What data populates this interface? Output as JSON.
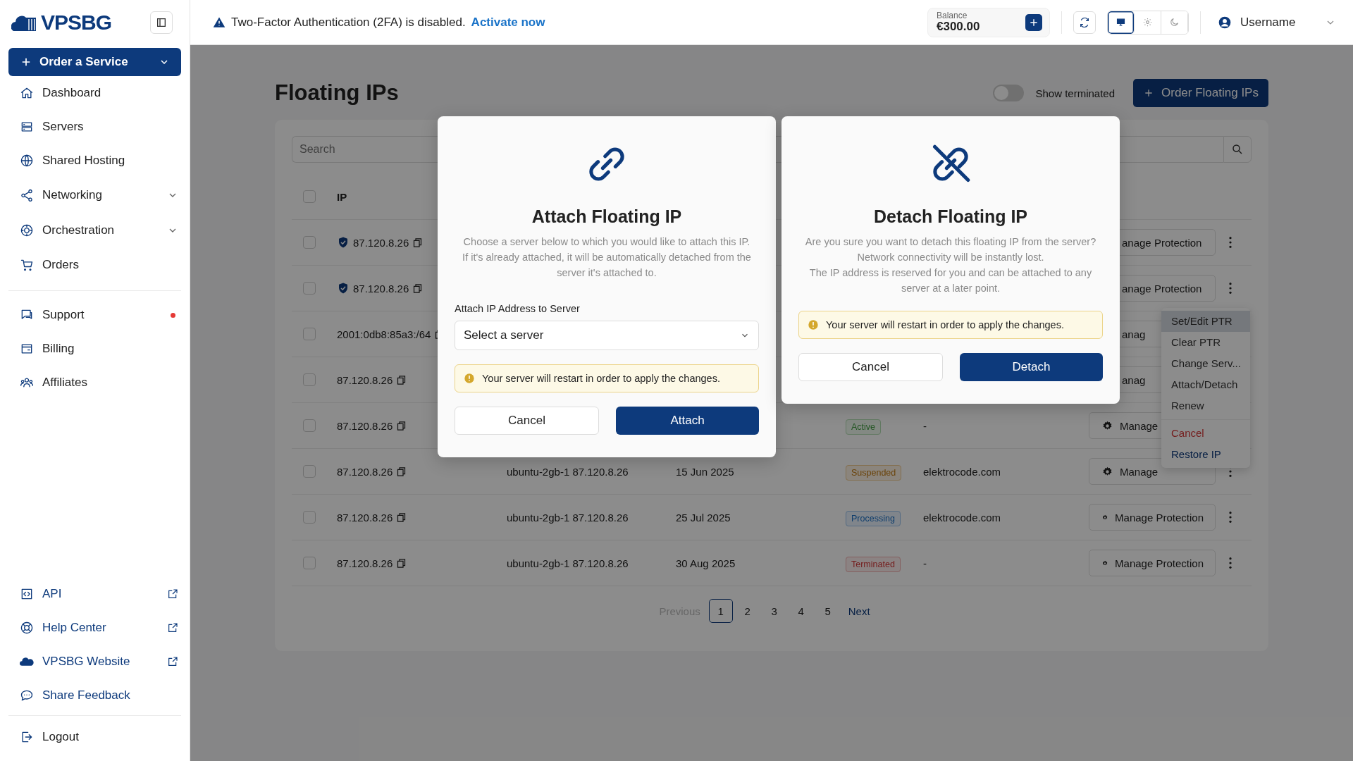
{
  "logo": {
    "text": "VPSBG"
  },
  "sidebar": {
    "order_button": "Order a Service",
    "groups": [
      {
        "items": [
          {
            "label": "Dashboard",
            "kind": "page"
          },
          {
            "label": "Servers",
            "kind": "page"
          },
          {
            "label": "Shared Hosting",
            "kind": "page"
          },
          {
            "label": "Networking",
            "kind": "page",
            "expandable": true
          },
          {
            "label": "Orchestration",
            "kind": "page",
            "expandable": true
          },
          {
            "label": "Orders",
            "kind": "page"
          }
        ]
      },
      {
        "items": [
          {
            "label": "Support",
            "kind": "page",
            "notification": true
          },
          {
            "label": "Billing",
            "kind": "page"
          },
          {
            "label": "Affiliates",
            "kind": "page"
          }
        ]
      },
      {
        "items": [
          {
            "label": "API",
            "kind": "link",
            "external": true
          },
          {
            "label": "Help Center",
            "kind": "link",
            "external": true
          },
          {
            "label": "VPSBG Website",
            "kind": "link",
            "external": true
          },
          {
            "label": "Share Feedback",
            "kind": "link"
          }
        ]
      },
      {
        "items": [
          {
            "label": "Logout",
            "kind": "page"
          }
        ]
      }
    ]
  },
  "topbar": {
    "alert": {
      "text": "Two-Factor Authentication (2FA) is disabled.",
      "link": "Activate now"
    },
    "balance": {
      "label": "Balance",
      "amount": "€300.00"
    },
    "theme_modes": [
      {
        "selected": true
      },
      {
        "selected": false
      },
      {
        "selected": false
      }
    ],
    "user": {
      "name": "Username"
    }
  },
  "page": {
    "title": "Floating IPs",
    "show_terminated": {
      "label": "Show terminated",
      "on": false
    },
    "order_button": "Order Floating IPs",
    "search": {
      "placeholder": "Search"
    },
    "table": {
      "columns": [
        {
          "label": "IP"
        }
      ],
      "header_checked": false,
      "rows": [
        {
          "checked": false,
          "protected": true,
          "ip": "87.120.8.26",
          "manage": {
            "label": "anage Protection",
            "gear": false
          },
          "menu_button": true
        },
        {
          "checked": false,
          "protected": true,
          "ip": "87.120.8.26",
          "manage": {
            "label": "anage Protection",
            "gear": false
          },
          "menu_button": true
        },
        {
          "checked": false,
          "protected": false,
          "ip": "2001:0db8:85a3:/64",
          "manage": {
            "label": "anag",
            "gear": false
          }
        },
        {
          "checked": false,
          "protected": false,
          "ip": "87.120.8.26",
          "manage": {
            "label": "anag",
            "gear": false
          }
        },
        {
          "checked": false,
          "protected": false,
          "ip": "87.120.8.26",
          "status": {
            "label": "Active",
            "kind": "active"
          },
          "domain": "-",
          "manage": {
            "label": "Manage",
            "gear": true
          }
        },
        {
          "checked": false,
          "protected": false,
          "ip": "87.120.8.26",
          "server": "ubuntu-2gb-1 87.120.8.26",
          "date": "15 Jun 2025",
          "status": {
            "label": "Suspended",
            "kind": "suspended"
          },
          "domain": "elektrocode.com",
          "manage": {
            "label": "Manage",
            "gear": true
          },
          "menu_button": true
        },
        {
          "checked": false,
          "protected": false,
          "ip": "87.120.8.26",
          "server": "ubuntu-2gb-1 87.120.8.26",
          "date": "25 Jul  2025",
          "status": {
            "label": "Processing",
            "kind": "processing"
          },
          "domain": "elektrocode.com",
          "manage": {
            "label": "Manage Protection",
            "gear": true
          },
          "menu_button": true
        },
        {
          "checked": false,
          "protected": false,
          "ip": "87.120.8.26",
          "server": "ubuntu-2gb-1 87.120.8.26",
          "date": "30 Aug 2025",
          "status": {
            "label": "Terminated",
            "kind": "terminated"
          },
          "domain": "-",
          "manage": {
            "label": "Manage Protection",
            "gear": true
          },
          "menu_button": true
        }
      ]
    },
    "pagination": {
      "previous": {
        "label": "Previous",
        "disabled": true
      },
      "pages": [
        {
          "label": "1",
          "selected": true
        },
        {
          "label": "2",
          "selected": false
        },
        {
          "label": "3",
          "selected": false
        },
        {
          "label": "4",
          "selected": false
        },
        {
          "label": "5",
          "selected": false
        }
      ],
      "next": {
        "label": "Next",
        "disabled": false
      }
    }
  },
  "row_menu": {
    "groups": [
      {
        "items": [
          {
            "label": "Set/Edit PTR",
            "kind": "normal",
            "selected": true
          },
          {
            "label": "Clear PTR",
            "kind": "normal",
            "selected": false
          },
          {
            "label": "Change Serv...",
            "kind": "normal",
            "selected": false
          },
          {
            "label": "Attach/Detach",
            "kind": "normal",
            "selected": false
          },
          {
            "label": "Renew",
            "kind": "normal",
            "selected": false
          }
        ]
      },
      {
        "items": [
          {
            "label": "Cancel",
            "kind": "danger",
            "selected": false
          },
          {
            "label": "Restore IP",
            "kind": "link",
            "selected": false
          }
        ]
      }
    ]
  },
  "modals": [
    {
      "kind": "attach",
      "title": "Attach Floating IP",
      "paragraphs": [
        [
          "Choose a server below to which you would like to attach this IP.",
          "If it's already attached, it will be automatically detached from the",
          "server it's attached to."
        ]
      ],
      "field": {
        "label": "Attach IP Address to Server",
        "placeholder": "Select a server"
      },
      "alert": "Your server will restart in order to apply the changes.",
      "cancel": "Cancel",
      "confirm": "Attach"
    },
    {
      "kind": "detach",
      "title": "Detach Floating IP",
      "paragraphs": [
        [
          "Are you sure you want to detach this floating IP from the server?",
          "Network connectivity will be instantly lost."
        ],
        [
          "The IP address is reserved for you and can be attached to any",
          "server at a later point."
        ]
      ],
      "alert": "Your server will restart in order to apply the changes.",
      "cancel": "Cancel",
      "confirm": "Detach"
    }
  ]
}
